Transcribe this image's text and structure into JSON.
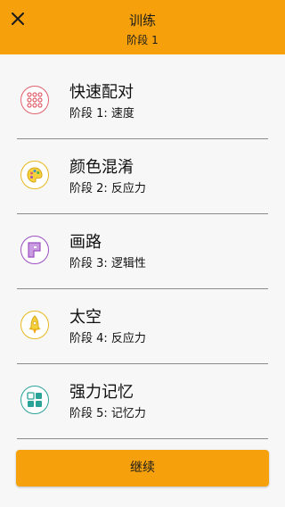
{
  "header": {
    "title": "训练",
    "subtitle": "阶段 1",
    "close_icon": "close-icon",
    "background_color": "#f6a10c"
  },
  "items": [
    {
      "name": "快速配对",
      "stage": "阶段 1: 速度",
      "icon": "dots-grid-icon",
      "color": "#e0606d"
    },
    {
      "name": "颜色混淆",
      "stage": "阶段 2: 反应力",
      "icon": "palette-icon",
      "color": "#e8b81f"
    },
    {
      "name": "画路",
      "stage": "阶段 3: 逻辑性",
      "icon": "path-icon",
      "color": "#9b4fc0"
    },
    {
      "name": "太空",
      "stage": "阶段 4: 反应力",
      "icon": "rocket-icon",
      "color": "#e8b81f"
    },
    {
      "name": "强力记忆",
      "stage": "阶段 5: 记忆力",
      "icon": "memory-grid-icon",
      "color": "#2ba399"
    }
  ],
  "footer": {
    "continue_label": "继续"
  }
}
